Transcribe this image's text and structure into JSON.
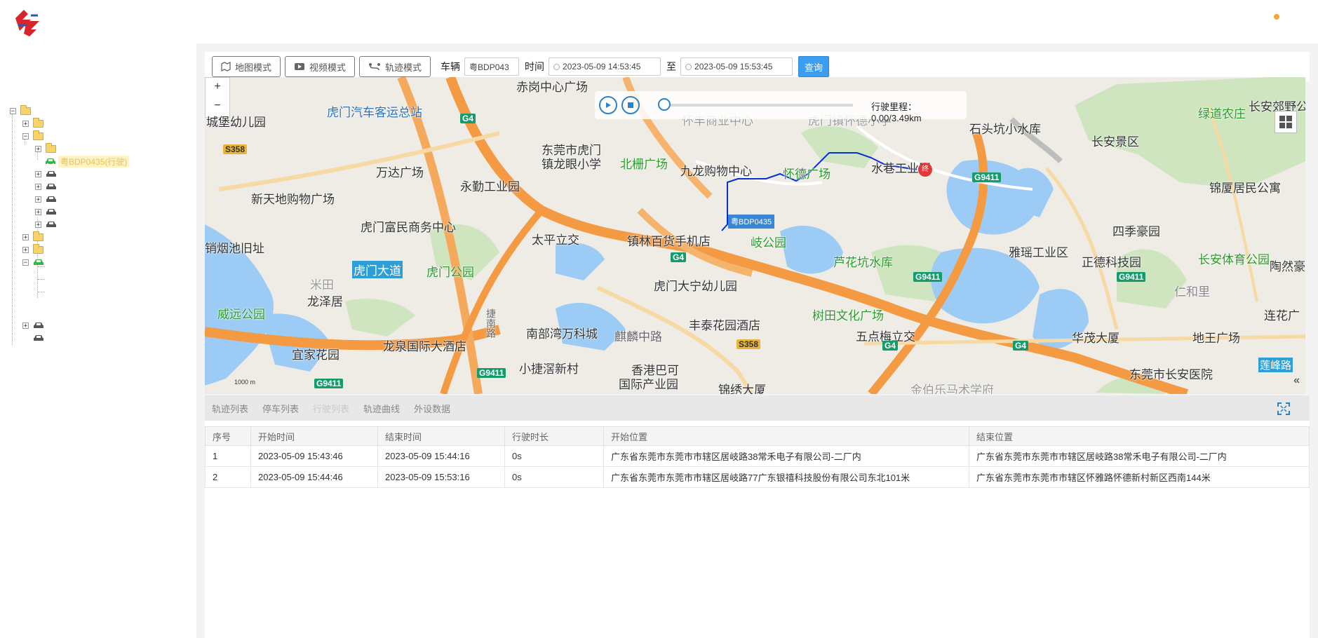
{
  "toolbar": {
    "map_mode_label": "地图模式",
    "video_mode_label": "视频模式",
    "track_mode_label": "轨迹模式",
    "vehicle_label": "车辆",
    "vehicle_value": "粤BDP043",
    "time_label": "时间",
    "start_time": "2023-05-09 14:53:45",
    "to_label": "至",
    "end_time": "2023-05-09 15:53:45",
    "query_label": "查询"
  },
  "tree": {
    "selected_vehicle": "粤BDP0435(行驶)"
  },
  "map": {
    "zoom_in": "+",
    "zoom_out": "−",
    "mileage": "行驶里程：0.00/3.49km",
    "vehicle_tag": "粤BDP0435",
    "end_marker": "终",
    "scale": "1000 m",
    "collapse": "«",
    "labels": [
      "赤岗中心广场",
      "虎门汽车客运总站",
      "城堡幼儿园",
      "东莞市虎门",
      "镇龙眼小学",
      "北栅广场",
      "九龙购物中心",
      "怀德广场",
      "水巷工业区",
      "石头坑小水库",
      "长安景区",
      "绿道农庄",
      "长安郊野公",
      "锦厦居民公寓",
      "万达广场",
      "永勤工业园",
      "新天地购物广场",
      "虎门富民商务中心",
      "太平立交",
      "镇林百货手机店",
      "岐公园",
      "四季豪园",
      "雅瑶工业区",
      "正德科技园",
      "长安体育公园",
      "陶然豪",
      "销烟池旧址",
      "虎门大道",
      "虎门公园",
      "芦花坑水库",
      "米田",
      "龙泽居",
      "虎门大宁幼儿园",
      "仁和里",
      "威远公园",
      "树田文化广场",
      "丰泰花园酒店",
      "五点梅立交",
      "华茂大厦",
      "地王广场",
      "连花广",
      "宜家花园",
      "龙泉国际大酒店",
      "南部湾万科城",
      "麒麟中路",
      "捷南路",
      "小捷滘新村",
      "香港巴可",
      "国际产业园",
      "锦绣大厦",
      "金伯乐马术学府",
      "东莞市长安医院",
      "莲峰路",
      "怀丰商业中心",
      "虎门镇怀德小学"
    ],
    "road_tags": [
      "G4",
      "S358",
      "G9411",
      "G4",
      "G9411",
      "G9411",
      "G4",
      "G4",
      "S358",
      "G9411",
      "G9411"
    ]
  },
  "tabs": [
    "轨迹列表",
    "停车列表",
    "行驶列表",
    "轨迹曲线",
    "外设数据"
  ],
  "table": {
    "headers": [
      "序号",
      "开始时间",
      "结束时间",
      "行驶时长",
      "开始位置",
      "结束位置"
    ],
    "rows": [
      [
        "1",
        "2023-05-09 15:43:46",
        "2023-05-09 15:44:16",
        "0s",
        "广东省东莞市东莞市市辖区居岐路38常禾电子有限公司-二厂内",
        "广东省东莞市东莞市市辖区居岐路38常禾电子有限公司-二厂内"
      ],
      [
        "2",
        "2023-05-09 15:44:46",
        "2023-05-09 15:53:16",
        "0s",
        "广东省东莞市东莞市市辖区居岐路77广东银禧科技股份有限公司东北101米",
        "广东省东莞市东莞市市辖区怀雅路怀德新村新区西南144米"
      ]
    ]
  },
  "colors": {
    "accent": "#3d9df0",
    "road_orange": "#f59d4c",
    "water": "#8fc6f3",
    "park": "#c8e3b8",
    "route": "#0a2fd1"
  }
}
